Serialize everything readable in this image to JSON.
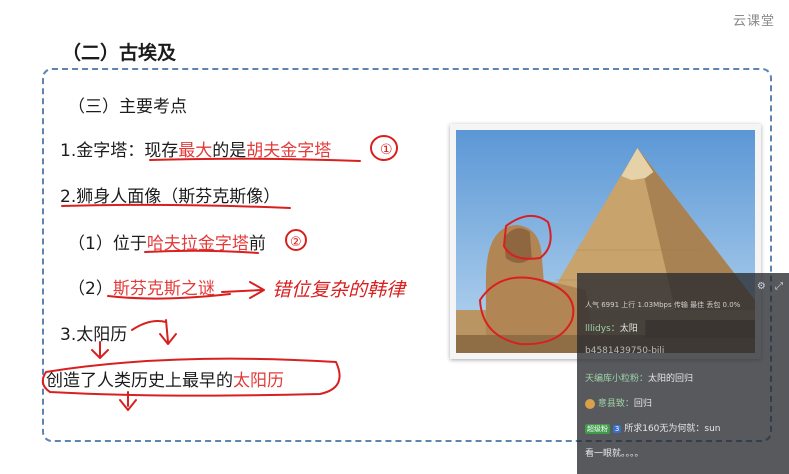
{
  "heading": "（二）古埃及",
  "logo_text": "云课堂",
  "lesson": {
    "subtitle": "（三）主要考点",
    "point1": {
      "prefix": "1.金字塔：",
      "text_a": "现存",
      "text_b": "最大",
      "text_c": "的是",
      "text_d": "胡夫金字塔"
    },
    "point2": {
      "text": "2.狮身人面像（斯芬克斯像）"
    },
    "point2_1": {
      "prefix": "（1）位于",
      "highlight": "哈夫拉金字塔",
      "suffix": "前"
    },
    "point2_2": {
      "prefix": "（2）",
      "highlight": "斯芬克斯之谜"
    },
    "point3": {
      "text": "3.太阳历"
    },
    "point3_desc": {
      "prefix": "创造了人类历史上最早的",
      "highlight": "太阳历"
    }
  },
  "annotations": {
    "mark1": "①",
    "mark2": "②",
    "note": "错位复杂的韩律"
  },
  "stream_panel": {
    "stats": "人气 6991    上行 1.03Mbps    传输 最佳    丢包 0.0%",
    "messages": [
      {
        "user": "lllidys：",
        "text": "太阳"
      },
      {
        "user": "",
        "text": "b4581439750-bili"
      },
      {
        "user": "天编库小粒粉：",
        "text": "太阳的回归"
      },
      {
        "user": "意县致：",
        "text": "回归"
      },
      {
        "user": "超级粉",
        "level": "3",
        "text": "所求160无为何就：sun"
      },
      {
        "user": "",
        "text": "看一眼就。。。。"
      }
    ]
  },
  "colors": {
    "accent": "#e43b3b",
    "frame": "#5e85b0",
    "ink": "#d92020"
  }
}
